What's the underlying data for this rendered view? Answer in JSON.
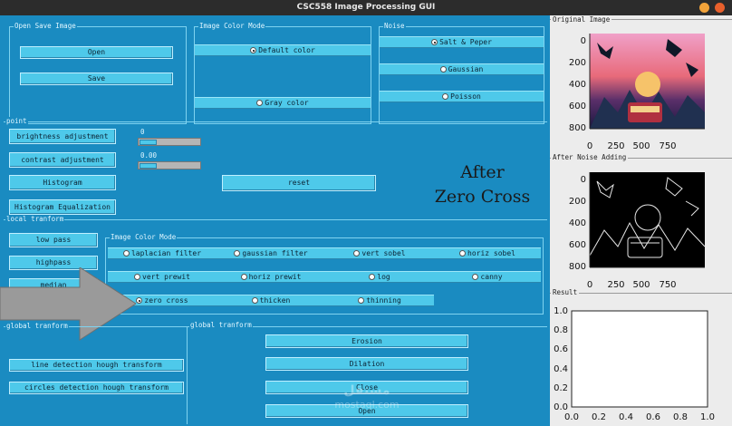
{
  "window": {
    "title": "CSC558 Image Processing GUI"
  },
  "open_save": {
    "label": "Open Save Image",
    "open": "Open",
    "save": "Save"
  },
  "color_mode": {
    "label": "Image Color Mode",
    "default": "Default color",
    "gray": "Gray color"
  },
  "noise": {
    "label": "Noise",
    "salt": "Salt & Peper",
    "gaussian": "Gaussian",
    "poisson": "Poisson"
  },
  "point": {
    "label": "point",
    "brightness": "brightness adjustment",
    "contrast": "contrast adjustment",
    "histogram": "Histogram",
    "hist_eq": "Histogram Equalization",
    "brightness_value": "0",
    "contrast_value": "0.00",
    "reset": "reset"
  },
  "result_text": {
    "line1": "After",
    "line2": "Zero Cross"
  },
  "local": {
    "label": "local tranform",
    "low_pass": "low pass",
    "highpass": "highpass",
    "median": "median"
  },
  "filters": {
    "label": "Image Color Mode",
    "items": [
      "laplacian filter",
      "gaussian filter",
      "vert sobel",
      "horiz sobel",
      "vert prewit",
      "horiz prewit",
      "log",
      "canny",
      "zero cross",
      "thicken",
      "thinning"
    ]
  },
  "global_left": {
    "label": "global tranform",
    "line_hough": "line detection hough transform",
    "circle_hough": "circles detection hough transform"
  },
  "global_right": {
    "label": "global tranform",
    "erosion": "Erosion",
    "dilation": "Dilation",
    "close": "Close",
    "open": "Open"
  },
  "panels": {
    "original": "Original Image",
    "noise": "After Noise Adding",
    "result": "Result"
  },
  "plot_axes": {
    "image_x_ticks": [
      "0",
      "250",
      "500",
      "750"
    ],
    "image_y_ticks": [
      "0",
      "200",
      "400",
      "600",
      "800"
    ],
    "result_ticks": [
      "0.0",
      "0.2",
      "0.4",
      "0.6",
      "0.8",
      "1.0"
    ]
  },
  "watermark": {
    "top": "مستقل",
    "bottom": "mostaql.com"
  },
  "colors": {
    "panel": "#1a8bc1",
    "button": "#4ec9ea",
    "close_btn": "#e8602c",
    "min_btn": "#f2a33a"
  }
}
